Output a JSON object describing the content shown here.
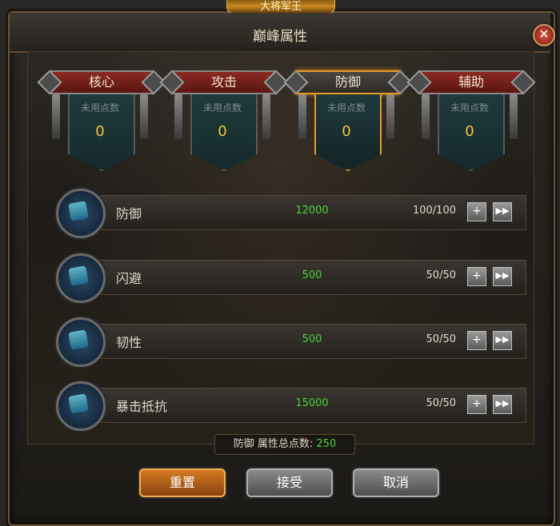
{
  "window": {
    "crest": "大将军王",
    "title": "巅峰属性",
    "close_glyph": "✕"
  },
  "tabs": [
    {
      "label": "核心",
      "unused_label": "未用点数",
      "count": "0",
      "active": false
    },
    {
      "label": "攻击",
      "unused_label": "未用点数",
      "count": "0",
      "active": false
    },
    {
      "label": "防御",
      "unused_label": "未用点数",
      "count": "0",
      "active": true
    },
    {
      "label": "辅助",
      "unused_label": "未用点数",
      "count": "0",
      "active": false
    }
  ],
  "attributes": [
    {
      "name": "防御",
      "value": "12000",
      "level": "100/100",
      "icon": "defense-rune-icon"
    },
    {
      "name": "闪避",
      "value": "500",
      "level": "50/50",
      "icon": "dodge-rune-icon"
    },
    {
      "name": "韧性",
      "value": "500",
      "level": "50/50",
      "icon": "tenacity-rune-icon"
    },
    {
      "name": "暴击抵抗",
      "value": "15000",
      "level": "50/50",
      "icon": "crit-resist-rune-icon"
    }
  ],
  "controls": {
    "plus_glyph": "+",
    "ff_glyph": "▶▶"
  },
  "total": {
    "label": "防御 属性总点数:",
    "value": "250"
  },
  "buttons": {
    "reset": "重置",
    "accept": "接受",
    "cancel": "取消"
  },
  "colors": {
    "accent_orange": "#e89a2a",
    "value_green": "#47d43a",
    "count_gold": "#f2c83a"
  }
}
